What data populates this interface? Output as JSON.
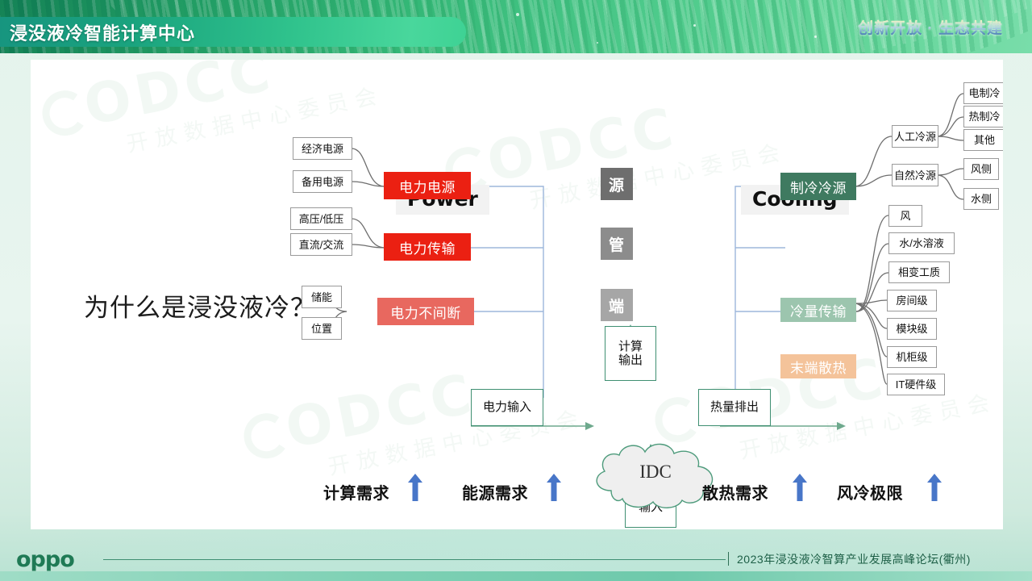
{
  "header": {
    "title": "浸没液冷智能计算中心",
    "slogan": "创新开放 · 生态共建"
  },
  "slide": {
    "question": "为什么是浸没液冷？",
    "sections": {
      "power_title": "Power",
      "cooling_title": "Cooling"
    },
    "power": {
      "leaves": [
        {
          "label": "经济电源"
        },
        {
          "label": "备用电源"
        },
        {
          "label": "高压/低压"
        },
        {
          "label": "直流/交流"
        },
        {
          "label": "储能"
        },
        {
          "label": "位置"
        }
      ],
      "main": [
        {
          "label": "电力电源",
          "color": "#EB2012"
        },
        {
          "label": "电力传输",
          "color": "#EB2012"
        },
        {
          "label": "电力不间断",
          "color": "#E8685F"
        }
      ]
    },
    "cooling": {
      "main": [
        {
          "label": "制冷冷源",
          "color": "#3F7A60"
        },
        {
          "label": "冷量传输",
          "color": "#9CC5AE"
        },
        {
          "label": "末端散热",
          "color": "#F4C39A"
        }
      ],
      "mid": [
        {
          "label": "人工冷源"
        },
        {
          "label": "自然冷源"
        }
      ],
      "leaves_artificial": [
        "电制冷",
        "热制冷",
        "其他"
      ],
      "leaves_natural": [
        "风侧",
        "水侧"
      ],
      "leaves_transfer": [
        "风",
        "水/水溶液",
        "相变工质"
      ],
      "leaves_terminal": [
        "房间级",
        "模块级",
        "机柜级",
        "IT硬件级"
      ]
    },
    "stages": [
      {
        "label": "源",
        "color": "#6E6E6E"
      },
      {
        "label": "管",
        "color": "#8C8C8C"
      },
      {
        "label": "端",
        "color": "#A6A6A6"
      }
    ],
    "flow": {
      "power_input": "电力输入",
      "heat_output": "热量排出",
      "compute_output": "计算\n输出",
      "info_input": "信息\n输入",
      "cloud": "IDC"
    },
    "demands": [
      {
        "label": "计算需求"
      },
      {
        "label": "能源需求"
      },
      {
        "label": "散热需求"
      },
      {
        "label": "风冷极限"
      }
    ],
    "accent_blue": "#4876C8",
    "connector_blue": "#9DB7DC",
    "connector_gray": "#6E6E6E"
  },
  "footer": {
    "logo": "oppo",
    "event": "2023年浸没液冷智算产业发展高峰论坛(衢州)"
  },
  "watermark": {
    "brand": "ODCC",
    "org": "开放数据中心委员会"
  }
}
